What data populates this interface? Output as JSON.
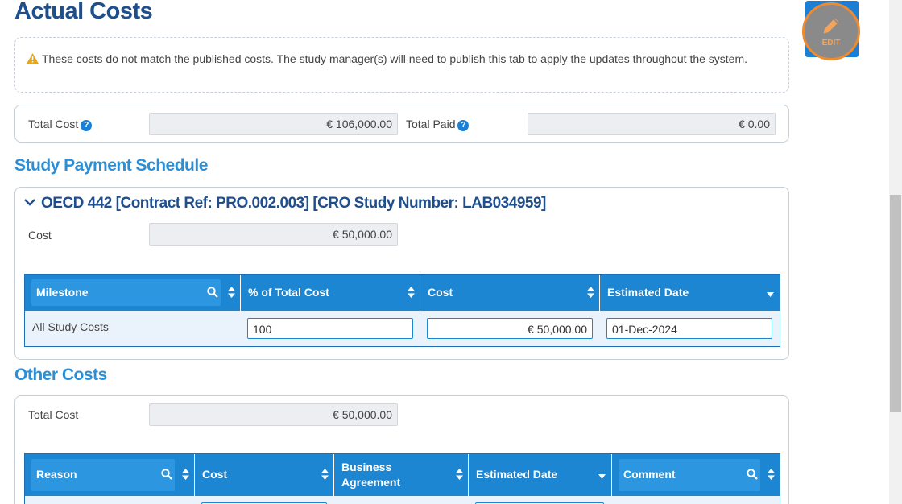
{
  "page_title": "Actual Costs",
  "edit_button": {
    "label": "EDIT"
  },
  "warning": {
    "text": "These costs do not match the published costs. The study manager(s) will need to publish this tab to apply the updates throughout the system."
  },
  "totals": {
    "total_cost_label": "Total Cost",
    "total_cost_value": "€ 106,000.00",
    "total_paid_label": "Total Paid",
    "total_paid_value": "€ 0.00",
    "help_glyph": "?"
  },
  "payment_schedule": {
    "title": "Study Payment Schedule",
    "study": {
      "title": "OECD 442 [Contract Ref: PRO.002.003] [CRO Study Number: LAB034959]",
      "cost_label": "Cost",
      "cost_value": "€ 50,000.00",
      "columns": [
        "Milestone",
        "% of Total Cost",
        "Cost",
        "Estimated Date"
      ],
      "rows": [
        {
          "milestone": "All Study Costs",
          "percent": "100",
          "cost": "€ 50,000.00",
          "date": "01-Dec-2024"
        }
      ]
    }
  },
  "other_costs": {
    "title": "Other Costs",
    "total_cost_label": "Total Cost",
    "total_cost_value": "€ 50,000.00",
    "columns": [
      "Reason",
      "Cost",
      "Business Agreement",
      "Estimated Date",
      "Comment"
    ]
  },
  "colors": {
    "header_blue": "#1c86d2",
    "title_navy": "#1f4e8c",
    "section_blue": "#2b8fd6",
    "edit_ring": "#f08a2c"
  },
  "icons": [
    "pencil-icon",
    "warning-icon",
    "help-icon",
    "chevron-down-icon",
    "search-icon",
    "sort-icon",
    "sort-down-icon"
  ]
}
